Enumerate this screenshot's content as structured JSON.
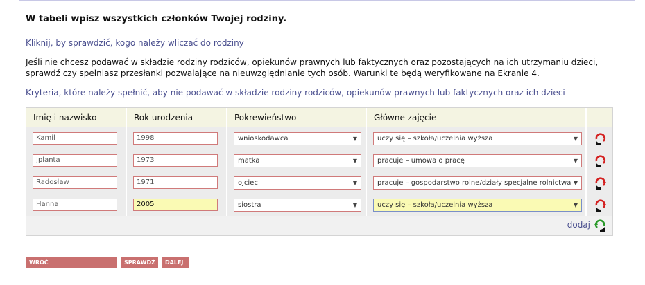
{
  "heading": "W tabeli wpisz wszystkich członków Twojej rodziny.",
  "link_who": "Kliknij, by sprawdzić, kogo należy wliczać do rodziny",
  "paragraph": "Jeśli nie chcesz podawać w składzie rodziny rodziców, opiekunów prawnych lub faktycznych oraz pozostających na ich utrzymaniu dzieci, sprawdź czy spełniasz przesłanki pozwalające na nieuwzględnianie tych osób. Warunki te będą weryfikowane na Ekranie 4.",
  "link_criteria": "Kryteria, które należy spełnić, aby nie podawać w składzie rodziny rodziców, opiekunów prawnych lub faktycznych oraz ich dzieci",
  "table": {
    "headers": [
      "Imię i nazwisko",
      "Rok urodzenia",
      "Pokrewieństwo",
      "Główne zajęcie"
    ],
    "rows": [
      {
        "name": "Kamil",
        "year": "1998",
        "relation": "wnioskodawca",
        "occupation": "uczy się – szkoła/uczelnia wyższa"
      },
      {
        "name": "Jplanta",
        "year": "1973",
        "relation": "matka",
        "occupation": "pracuje – umowa o pracę"
      },
      {
        "name": "Radosław",
        "year": "1971",
        "relation": "ojciec",
        "occupation": "pracuje – gospodarstwo rolne/działy specjalne rolnictwa"
      },
      {
        "name": "Hanna",
        "year": "2005",
        "relation": "siostra",
        "occupation": "uczy się – szkoła/uczelnia wyższa"
      }
    ],
    "add_label": "dodaj"
  },
  "buttons": {
    "back": "WRÓĆ",
    "check": "SPRAWDŹ",
    "next": "DALEJ"
  },
  "colors": {
    "link": "#4a4f8f",
    "button": "#c9706f",
    "highlight": "#fafab4",
    "input_border": "#d07a7a"
  }
}
